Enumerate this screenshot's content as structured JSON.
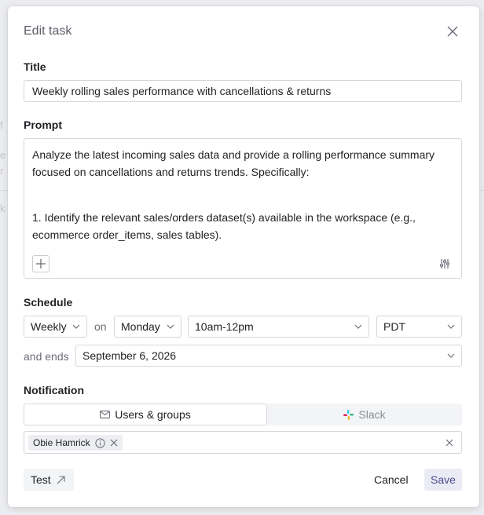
{
  "modal": {
    "title": "Edit task"
  },
  "title_section": {
    "label": "Title",
    "value": "Weekly rolling sales performance with cancellations & returns"
  },
  "prompt_section": {
    "label": "Prompt",
    "paragraph_1": "Analyze the latest incoming sales data and provide a rolling performance summary focused on cancellations and returns trends. Specifically:",
    "paragraph_2": "1. Identify the relevant sales/orders dataset(s) available in the workspace (e.g., ecommerce order_items, sales tables)."
  },
  "schedule": {
    "label": "Schedule",
    "frequency": "Weekly",
    "on_text": "on",
    "day": "Monday",
    "time": "10am-12pm",
    "timezone": "PDT",
    "ends_text": "and ends",
    "end_date": "September 6, 2026"
  },
  "notification": {
    "label": "Notification",
    "tab_users": "Users & groups",
    "tab_slack": "Slack",
    "recipients": [
      "Obie Hamrick"
    ]
  },
  "footer": {
    "test_label": "Test",
    "cancel_label": "Cancel",
    "save_label": "Save"
  },
  "icons": {
    "close": "close-icon",
    "plus": "plus-icon",
    "tune": "tune-icon",
    "chevron": "chevron-down-icon",
    "mail": "mail-icon",
    "slack": "slack-icon",
    "info": "info-icon",
    "external": "external-arrow-icon"
  },
  "colors": {
    "save_bg": "#ebebf6",
    "save_text": "#4b4c8c",
    "border": "#d5d7dc",
    "muted": "#6b6e77"
  }
}
